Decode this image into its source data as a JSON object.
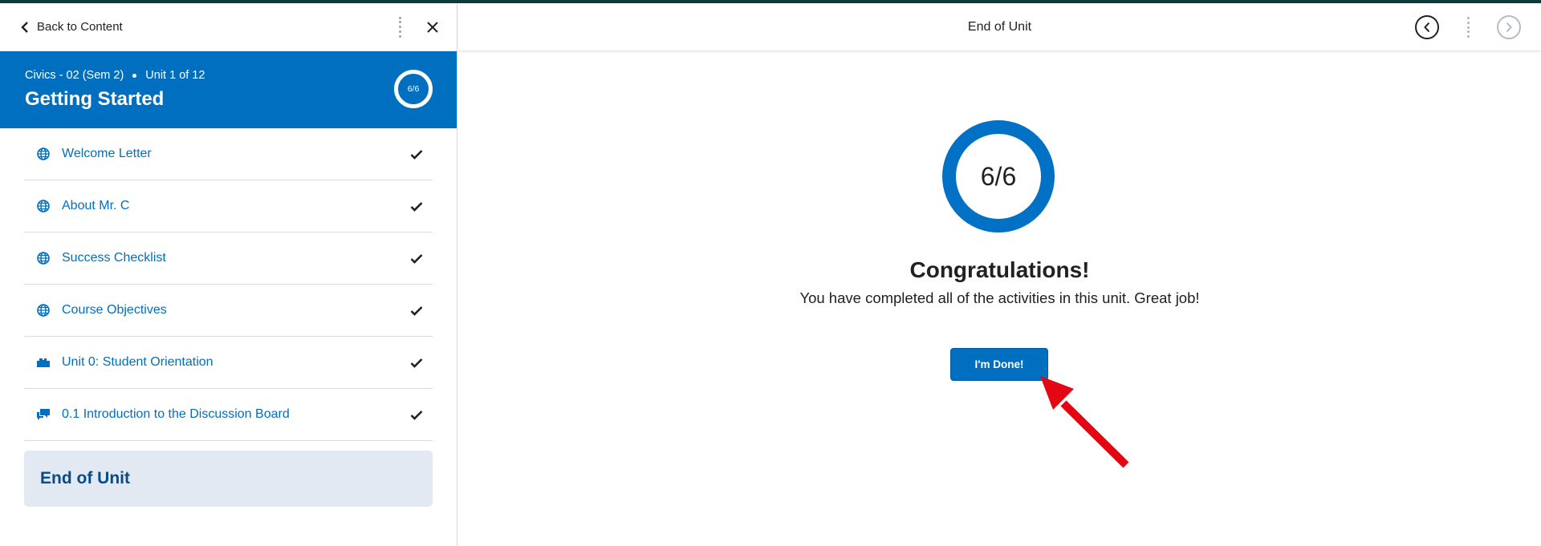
{
  "sidebar": {
    "back_label": "Back to Content",
    "unit": {
      "course": "Civics - 02 (Sem 2)",
      "unit_index": "Unit 1 of 12",
      "title": "Getting Started",
      "progress": "6/6"
    },
    "items": [
      {
        "label": "Welcome Letter",
        "icon": "globe-icon",
        "completed": true
      },
      {
        "label": "About Mr. C",
        "icon": "globe-icon",
        "completed": true
      },
      {
        "label": "Success Checklist",
        "icon": "globe-icon",
        "completed": true
      },
      {
        "label": "Course Objectives",
        "icon": "globe-icon",
        "completed": true
      },
      {
        "label": "Unit 0: Student Orientation",
        "icon": "puzzle-icon",
        "completed": true
      },
      {
        "label": "0.1 Introduction to the Discussion Board",
        "icon": "discussion-icon",
        "completed": true
      }
    ],
    "end_unit_label": "End of Unit"
  },
  "main": {
    "title": "End of Unit",
    "progress": "6/6",
    "congrats": "Congratulations!",
    "message": "You have completed all of the activities in this unit. Great job!",
    "done_button": "I'm Done!"
  },
  "colors": {
    "accent": "#006fbf",
    "top_strip": "#0b3b3a",
    "end_unit_bg": "#e3e9f2",
    "annotation_arrow": "#e30613"
  }
}
